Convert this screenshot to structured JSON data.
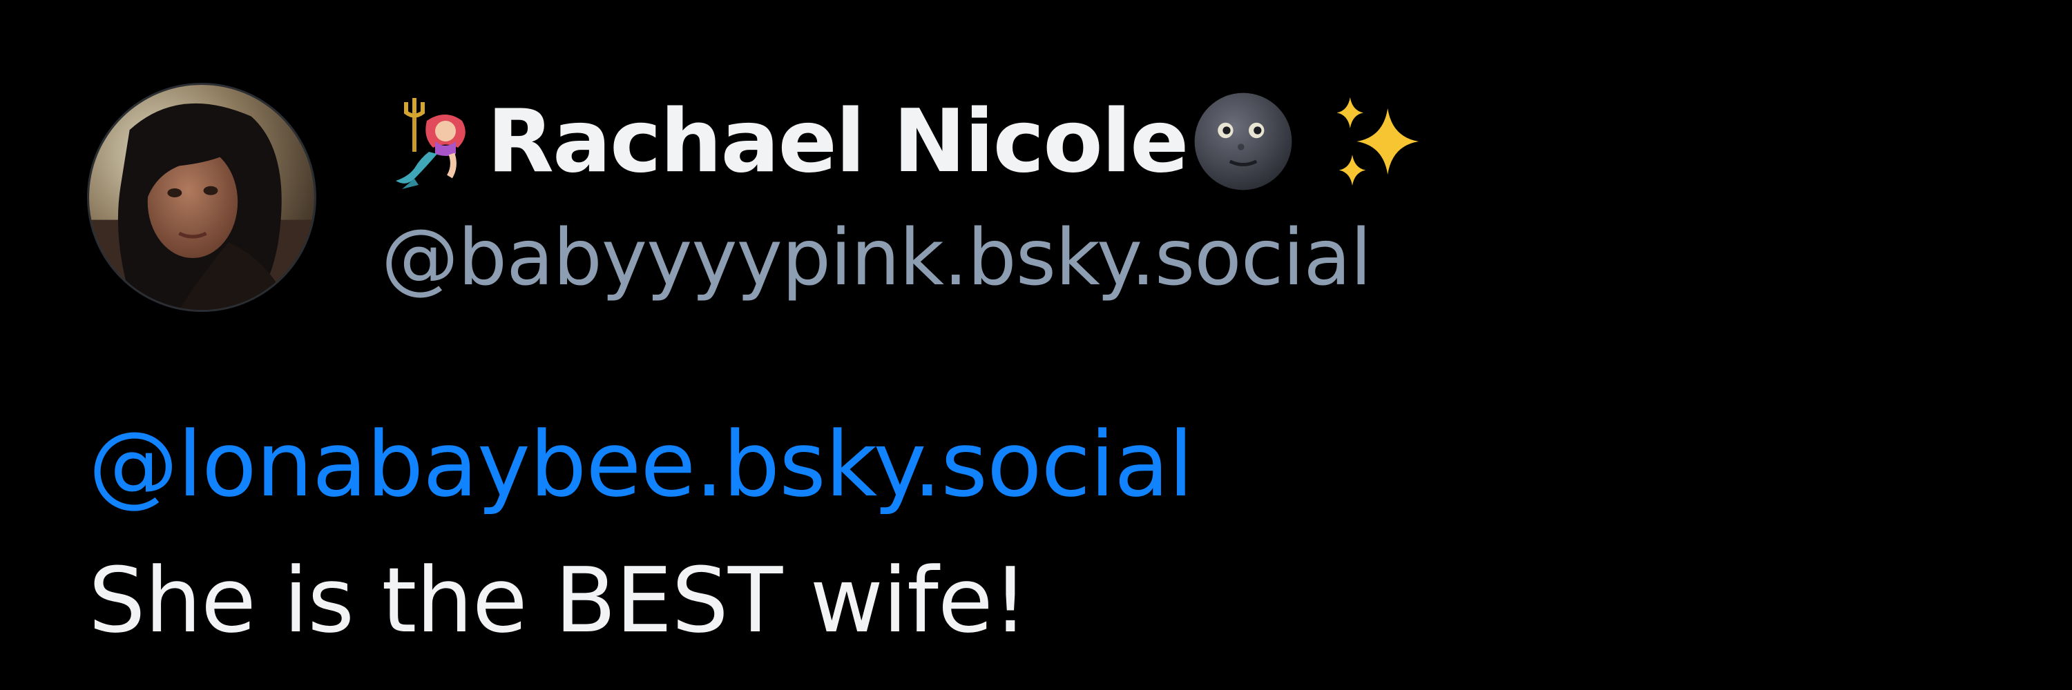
{
  "post": {
    "author": {
      "display_name": "Rachael Nicole",
      "handle": "@babyyyypink.bsky.social",
      "avatar_icon": "profile-photo",
      "emojis": [
        "mermaid-emoji",
        "new-moon-face-emoji",
        "sparkles-emoji"
      ]
    },
    "mention": "@lonabaybee.bsky.social",
    "text": "She is the BEST wife!"
  },
  "colors": {
    "background": "#000000",
    "display_name": "#f1f3f5",
    "handle": "#8d9eb2",
    "mention_link": "#1183fe",
    "body_text": "#f1f3f5"
  }
}
